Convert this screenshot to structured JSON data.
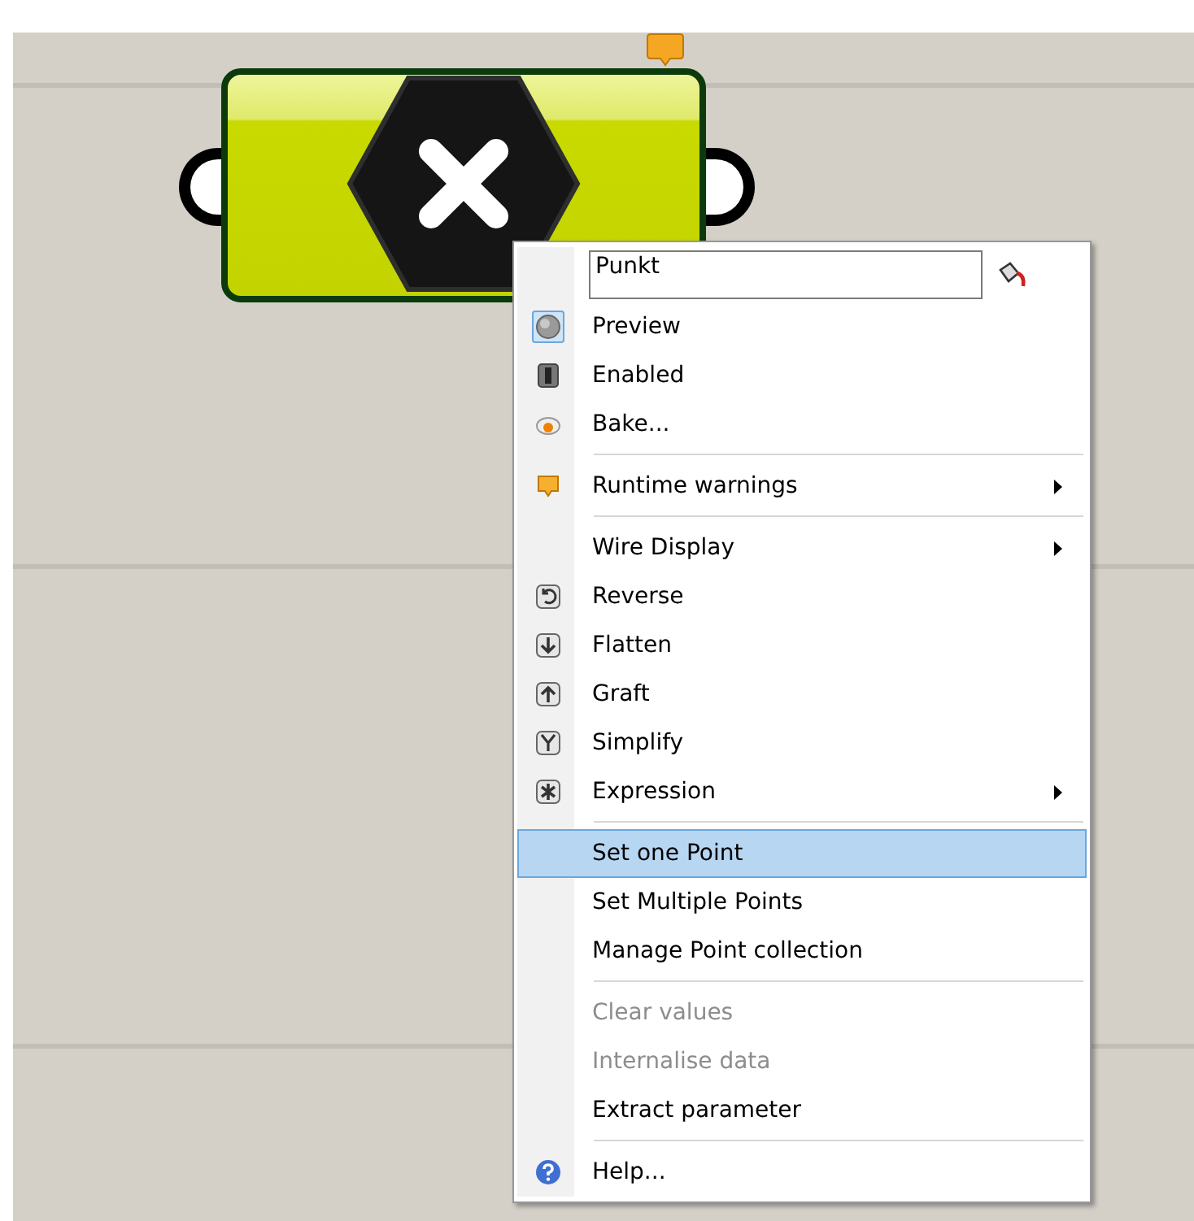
{
  "menu": {
    "name_field": {
      "value": "Punkt"
    },
    "items": [
      {
        "kind": "item",
        "label": "Preview",
        "checked": true,
        "disabled": false,
        "selected": false,
        "submenu": false
      },
      {
        "kind": "item",
        "label": "Enabled",
        "checked": false,
        "disabled": false,
        "selected": false,
        "submenu": false
      },
      {
        "kind": "item",
        "label": "Bake...",
        "disabled": false,
        "selected": false,
        "submenu": false
      },
      {
        "kind": "separator"
      },
      {
        "kind": "item",
        "label": "Runtime warnings",
        "disabled": false,
        "selected": false,
        "submenu": true
      },
      {
        "kind": "separator"
      },
      {
        "kind": "item",
        "label": "Wire Display",
        "disabled": false,
        "selected": false,
        "submenu": true
      },
      {
        "kind": "item",
        "label": "Reverse",
        "disabled": false,
        "selected": false,
        "submenu": false
      },
      {
        "kind": "item",
        "label": "Flatten",
        "disabled": false,
        "selected": false,
        "submenu": false
      },
      {
        "kind": "item",
        "label": "Graft",
        "disabled": false,
        "selected": false,
        "submenu": false
      },
      {
        "kind": "item",
        "label": "Simplify",
        "disabled": false,
        "selected": false,
        "submenu": false
      },
      {
        "kind": "item",
        "label": "Expression",
        "disabled": false,
        "selected": false,
        "submenu": true
      },
      {
        "kind": "separator"
      },
      {
        "kind": "item",
        "label": "Set one Point",
        "disabled": false,
        "selected": true,
        "submenu": false
      },
      {
        "kind": "item",
        "label": "Set Multiple Points",
        "disabled": false,
        "selected": false,
        "submenu": false
      },
      {
        "kind": "item",
        "label": "Manage Point collection",
        "disabled": false,
        "selected": false,
        "submenu": false
      },
      {
        "kind": "separator"
      },
      {
        "kind": "item",
        "label": "Clear values",
        "disabled": true,
        "selected": false,
        "submenu": false
      },
      {
        "kind": "item",
        "label": "Internalise data",
        "disabled": true,
        "selected": false,
        "submenu": false
      },
      {
        "kind": "item",
        "label": "Extract parameter",
        "disabled": false,
        "selected": false,
        "submenu": false
      },
      {
        "kind": "separator"
      },
      {
        "kind": "item",
        "label": "Help...",
        "disabled": false,
        "selected": false,
        "submenu": false
      }
    ]
  }
}
